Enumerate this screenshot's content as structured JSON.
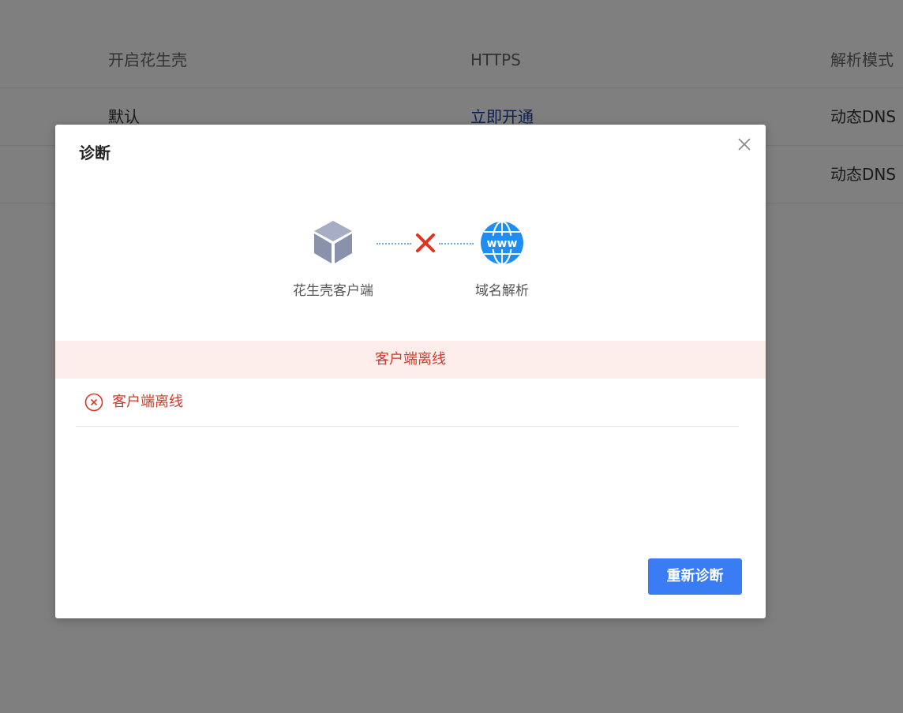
{
  "background_table": {
    "headers": [
      "开启花生壳",
      "HTTPS",
      "解析模式"
    ],
    "rows": [
      {
        "col1": "默认",
        "col2": "立即开通",
        "col3": "动态DNS"
      },
      {
        "col1": "",
        "col2": "",
        "col3": "动态DNS"
      }
    ]
  },
  "dialog": {
    "title": "诊断",
    "close_icon": "close-icon",
    "diagram": {
      "source_label": "花生壳客户端",
      "source_icon": "cube-icon",
      "target_label": "域名解析",
      "target_icon": "globe-www-icon",
      "target_icon_text": "www",
      "connection_status_icon": "x-mark-icon"
    },
    "status_banner": "客户端离线",
    "results": [
      {
        "icon": "error-circle-icon",
        "text": "客户端离线"
      }
    ],
    "rediagnose_label": "重新诊断"
  },
  "colors": {
    "accent": "#3a7cf4",
    "error": "#d43a2a",
    "banner_bg": "#fdeeec",
    "link": "#1a3fa8"
  }
}
